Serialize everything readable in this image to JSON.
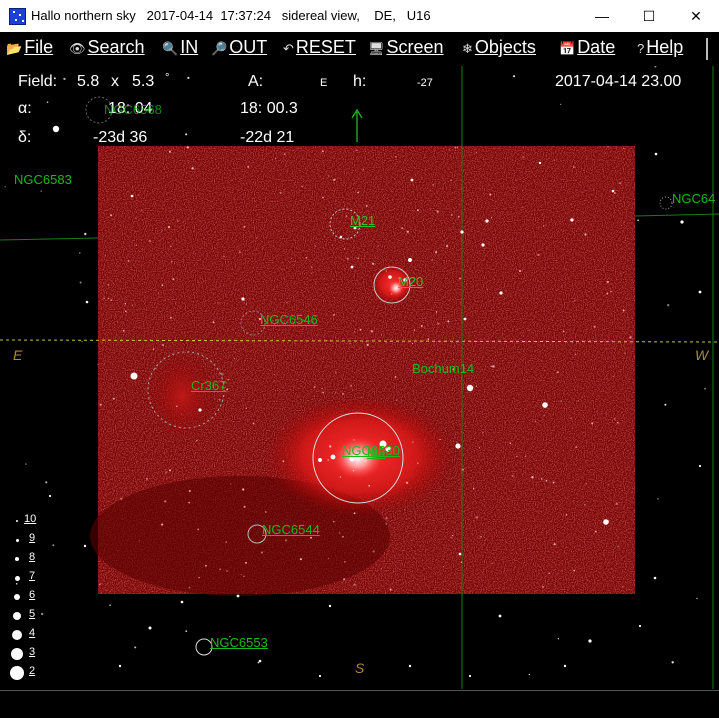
{
  "window": {
    "title": "Hallo northern sky   2017-04-14  17:37:24   sidereal view,    DE,   U16",
    "minimize": "—",
    "maximize": "☐",
    "close": "✕"
  },
  "menu": [
    {
      "key": "file",
      "label": "File",
      "icon": "folder-icon",
      "glyph": "📂"
    },
    {
      "key": "search",
      "label": "Search",
      "icon": "binoculars-icon",
      "glyph": "👁"
    },
    {
      "key": "in",
      "label": "IN",
      "icon": "zoom-in-icon",
      "glyph": "🔍"
    },
    {
      "key": "out",
      "label": "OUT",
      "icon": "zoom-out-icon",
      "glyph": "🔎"
    },
    {
      "key": "reset",
      "label": "RESET",
      "icon": "reset-arrow-icon",
      "glyph": "↶"
    },
    {
      "key": "screen",
      "label": "Screen",
      "icon": "monitor-icon",
      "glyph": "🖥"
    },
    {
      "key": "objects",
      "label": "Objects",
      "icon": "objects-icon",
      "glyph": "❄"
    },
    {
      "key": "date",
      "label": "Date",
      "icon": "calendar-icon",
      "glyph": "📅"
    },
    {
      "key": "help",
      "label": "Help",
      "icon": "question-icon",
      "glyph": "?"
    }
  ],
  "readout": {
    "field_label": "Field:",
    "field_w": "5.8",
    "field_x": "x",
    "field_h": "5.3",
    "field_unit": "°",
    "a_label": "A:",
    "a_value": "E",
    "h_label": "h:",
    "h_value": "-27",
    "datetime": "2017-04-14  23.00",
    "alpha_label": "α:",
    "alpha_1": "18: 04",
    "alpha_2": "18: 00.3",
    "delta_label": "δ:",
    "delta_1": "-23d 36",
    "delta_2": "-22d 21"
  },
  "objects": [
    {
      "name": "NGC6583",
      "style": "plain"
    },
    {
      "name": "NGC64",
      "style": "plain"
    },
    {
      "name": "M21",
      "style": "underline"
    },
    {
      "name": "M20",
      "style": "underline"
    },
    {
      "name": "NGC6546",
      "style": "underline"
    },
    {
      "name": "Bochum14",
      "style": "plain"
    },
    {
      "name": "Cr367",
      "style": "underline"
    },
    {
      "name": "M8",
      "style": "underline"
    },
    {
      "name": "NGC6530",
      "style": "underline"
    },
    {
      "name": "NGC6544",
      "style": "underline"
    },
    {
      "name": "NGC6553",
      "style": "underline"
    },
    {
      "name": "NGC6568",
      "style": "plain"
    }
  ],
  "directions": {
    "east": "E",
    "west": "W",
    "south": "S"
  },
  "magnitude_scale": [
    "10",
    "9",
    "8",
    "7",
    "6",
    "5",
    "4",
    "3",
    "2"
  ],
  "colors": {
    "label_green": "#1cb81c",
    "horizon": "#c8c832",
    "meridian": "#1a7a1a",
    "nebula": "#7a0000",
    "compass": "#b08838"
  }
}
